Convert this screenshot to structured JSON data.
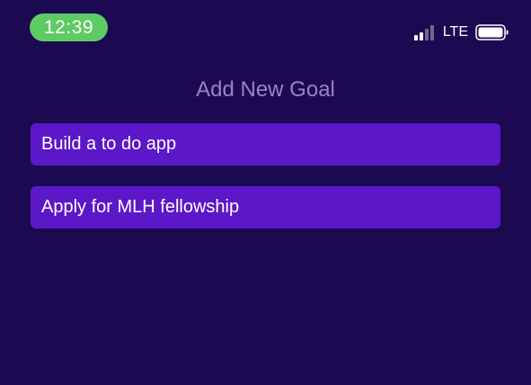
{
  "status_bar": {
    "time": "12:39",
    "network": "LTE",
    "signal_icon": "cellular-signal-icon",
    "battery_icon": "battery-icon"
  },
  "colors": {
    "background": "#1b0a52",
    "time_pill": "#5ecb63",
    "title_text": "#a07fc8",
    "goal_item": "#5b17c8"
  },
  "header": {
    "title": "Add New Goal"
  },
  "goals": [
    {
      "label": "Build a to do app"
    },
    {
      "label": "Apply for MLH fellowship"
    }
  ]
}
